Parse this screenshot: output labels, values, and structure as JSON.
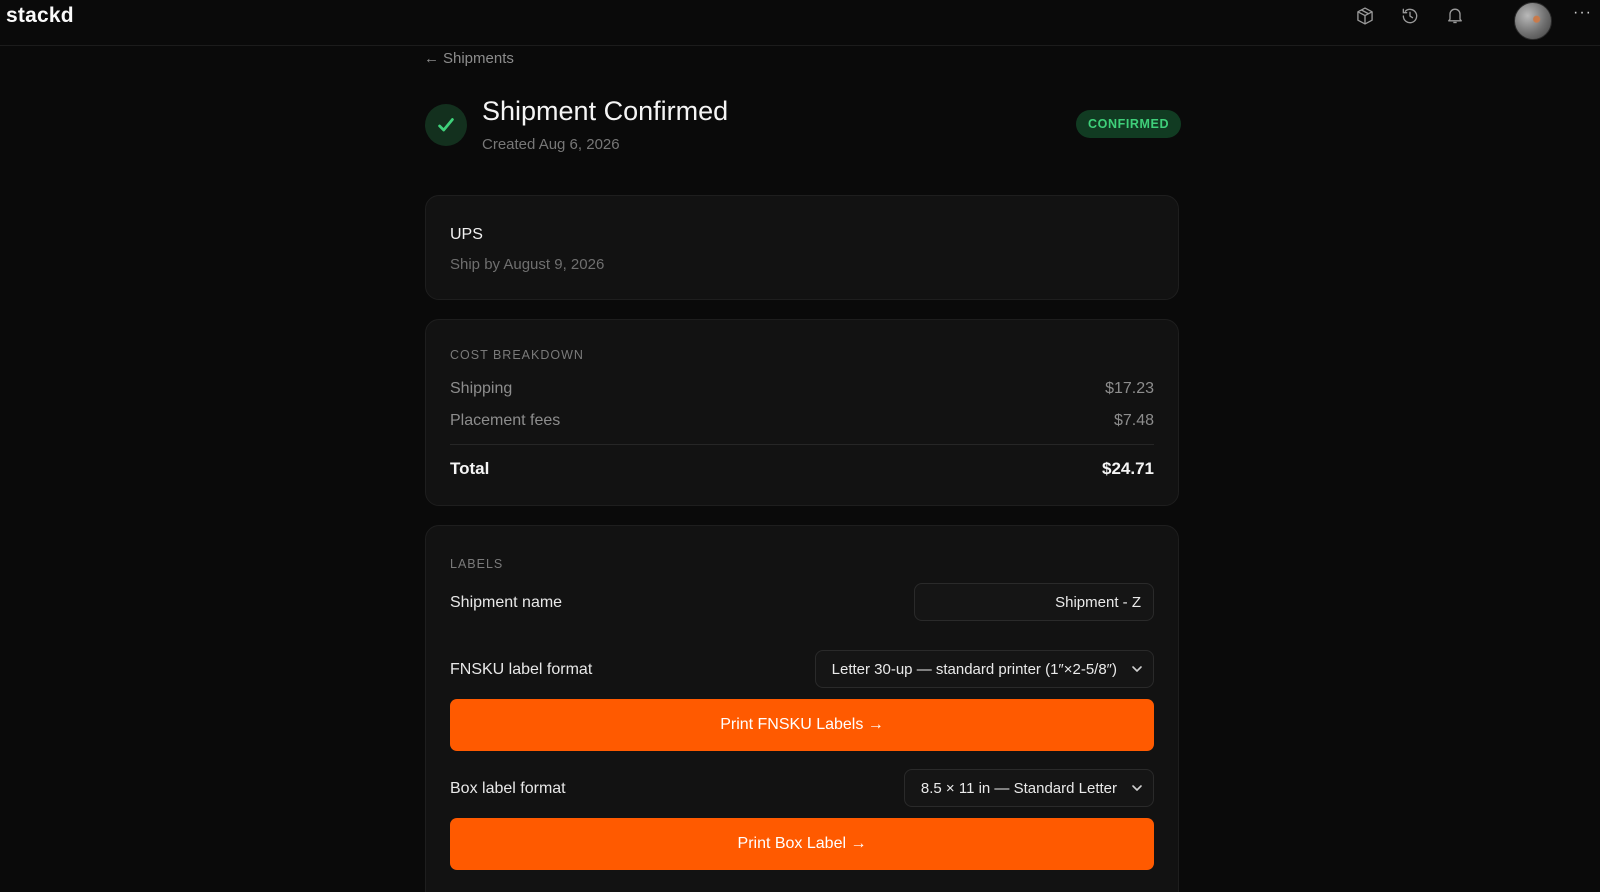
{
  "app": {
    "brand": "stackd"
  },
  "topbar": {
    "icons": [
      "package-icon",
      "history-icon",
      "bell-icon",
      "avatar",
      "more-icon"
    ],
    "more_label": "···"
  },
  "breadcrumb": {
    "arrow": "←",
    "label": "Shipments"
  },
  "header": {
    "title": "Shipment Confirmed",
    "created": "Created Aug 6, 2026",
    "status": "CONFIRMED",
    "status_color": "#3fd07a"
  },
  "carrier": {
    "name": "UPS",
    "ship_by": "Ship by August 9, 2026"
  },
  "cost": {
    "section_label": "COST BREAKDOWN",
    "rows": [
      {
        "label": "Shipping",
        "value": "$17.23"
      },
      {
        "label": "Placement fees",
        "value": "$7.48"
      }
    ],
    "total_label": "Total",
    "total_value": "$24.71"
  },
  "labels": {
    "section_label": "LABELS",
    "shipment_name_label": "Shipment name",
    "shipment_name_value": "Shipment - Z",
    "fnsku_label": "FNSKU label format",
    "fnsku_selected": "Letter 30-up — standard printer (1″×2-5/8″)",
    "fnsku_button": "Print FNSKU Labels →",
    "box_label": "Box label format",
    "box_selected": "8.5 × 11 in — Standard Letter",
    "box_button": "Print Box Label →",
    "accent": "#ff5a00"
  }
}
